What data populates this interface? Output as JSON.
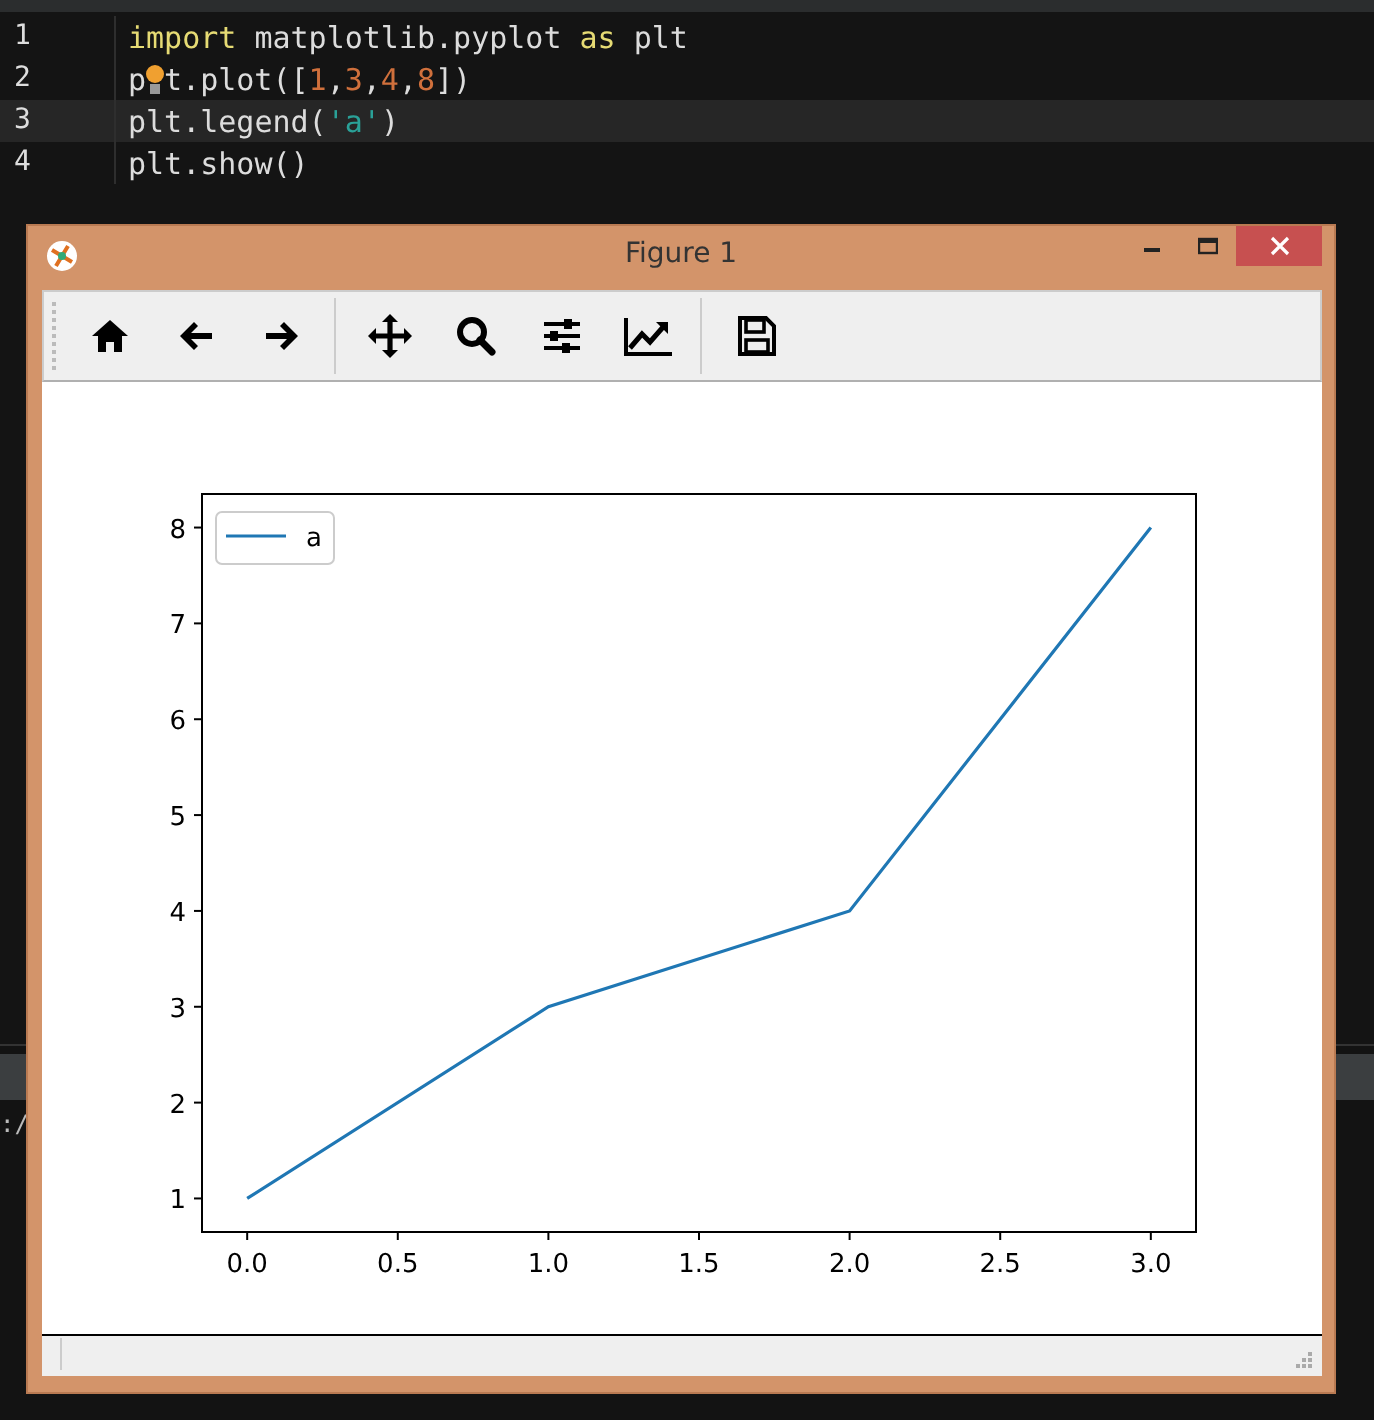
{
  "editor": {
    "lines": [
      {
        "number": "1",
        "current": false,
        "tokens": [
          {
            "text": "import",
            "kind": "keyword"
          },
          {
            "text": " matplotlib.pyplot ",
            "kind": "plain"
          },
          {
            "text": "as",
            "kind": "keyword"
          },
          {
            "text": " plt",
            "kind": "plain"
          }
        ]
      },
      {
        "number": "2",
        "current": false,
        "tokens": [
          {
            "text": "p",
            "kind": "plain"
          },
          {
            "kind": "bulb"
          },
          {
            "text": "t.plot([",
            "kind": "plain"
          },
          {
            "text": "1",
            "kind": "number"
          },
          {
            "text": ",",
            "kind": "plain"
          },
          {
            "text": "3",
            "kind": "number"
          },
          {
            "text": ",",
            "kind": "plain"
          },
          {
            "text": "4",
            "kind": "number"
          },
          {
            "text": ",",
            "kind": "plain"
          },
          {
            "text": "8",
            "kind": "number"
          },
          {
            "text": "])",
            "kind": "plain"
          }
        ]
      },
      {
        "number": "3",
        "current": true,
        "tokens": [
          {
            "text": "plt.legend(",
            "kind": "plain"
          },
          {
            "text": "'a'",
            "kind": "string"
          },
          {
            "text": ")",
            "kind": "plain"
          }
        ]
      },
      {
        "number": "4",
        "current": false,
        "tokens": [
          {
            "text": "plt.show()",
            "kind": "plain"
          }
        ]
      }
    ]
  },
  "console": {
    "text": ":/"
  },
  "figure_window": {
    "title": "Figure 1",
    "chart_data": {
      "type": "line",
      "x": [
        0,
        1,
        2,
        3
      ],
      "series": [
        {
          "name": "a",
          "color": "#1f77b4",
          "values": [
            1,
            3,
            4,
            8
          ]
        }
      ],
      "xlim": [
        -0.15,
        3.15
      ],
      "ylim": [
        0.65,
        8.35
      ],
      "xticks": [
        {
          "value": 0,
          "label": "0.0"
        },
        {
          "value": 0.5,
          "label": "0.5"
        },
        {
          "value": 1,
          "label": "1.0"
        },
        {
          "value": 1.5,
          "label": "1.5"
        },
        {
          "value": 2,
          "label": "2.0"
        },
        {
          "value": 2.5,
          "label": "2.5"
        },
        {
          "value": 3,
          "label": "3.0"
        }
      ],
      "yticks": [
        1,
        2,
        3,
        4,
        5,
        6,
        7,
        8
      ]
    }
  }
}
